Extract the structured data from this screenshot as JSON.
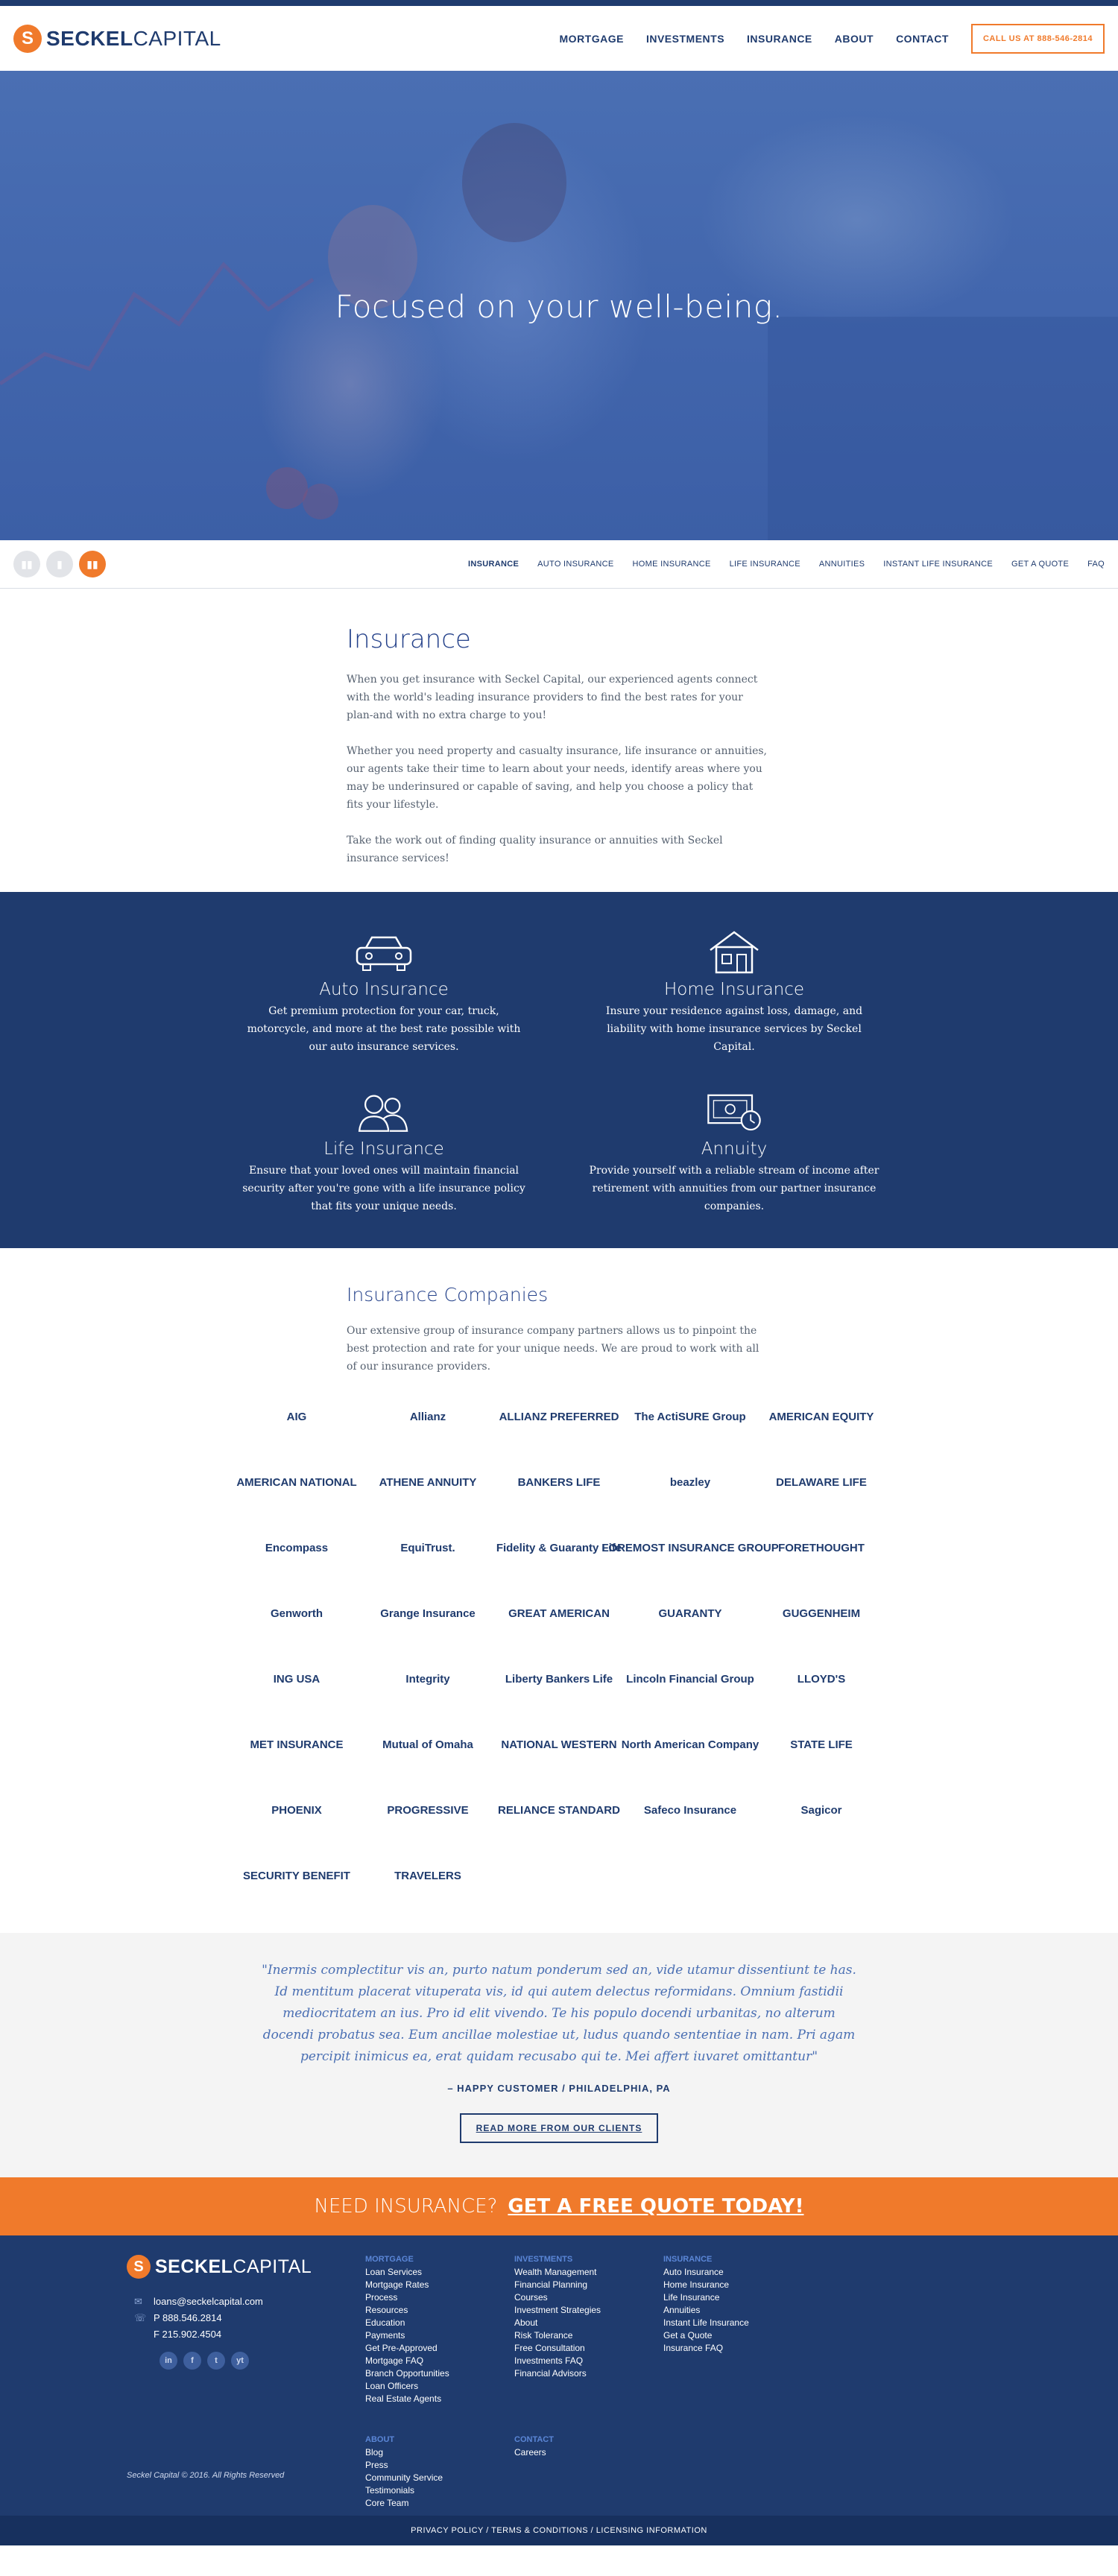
{
  "brand": {
    "bold": "SECKEL",
    "light": "CAPITAL",
    "mark": "S"
  },
  "nav": {
    "items": [
      "MORTGAGE",
      "INVESTMENTS",
      "INSURANCE",
      "ABOUT",
      "CONTACT"
    ],
    "call": "CALL US AT 888-546-2814"
  },
  "hero": {
    "title": "Focused on your well-being."
  },
  "subnav": {
    "items": [
      "INSURANCE",
      "AUTO INSURANCE",
      "HOME INSURANCE",
      "LIFE INSURANCE",
      "ANNUITIES",
      "INSTANT LIFE INSURANCE",
      "GET A QUOTE",
      "FAQ"
    ]
  },
  "intro": {
    "title": "Insurance",
    "paragraphs": [
      "When you get insurance with Seckel Capital, our experienced agents connect with the world's leading insurance providers to find the best rates for your plan-and with no extra charge to you!",
      "Whether you need property and casualty insurance, life insurance or annuities, our agents take their time to learn about your needs, identify areas where you may be underinsured or capable of saving, and help you choose a policy that fits your lifestyle.",
      "Take the work out of finding quality insurance or annuities with Seckel insurance services!"
    ]
  },
  "services": [
    {
      "title": "Auto Insurance",
      "icon": "car-icon",
      "text": "Get premium protection for your car, truck, motorcycle, and more at the best rate possible with our auto insurance services."
    },
    {
      "title": "Home Insurance",
      "icon": "house-icon",
      "text": "Insure your residence against loss, damage, and liability with home insurance services by Seckel Capital."
    },
    {
      "title": "Life Insurance",
      "icon": "people-icon",
      "text": "Ensure that your loved ones will maintain financial security after you're gone with a life insurance policy that fits your unique needs."
    },
    {
      "title": "Annuity",
      "icon": "money-clock-icon",
      "text": "Provide yourself with a reliable stream of income after retirement with annuities from our partner insurance companies."
    }
  ],
  "companies": {
    "title": "Insurance Companies",
    "text": "Our extensive group of insurance company partners allows us to pinpoint the best protection and rate for your unique needs. We are proud to work with all of our insurance providers.",
    "logos": [
      "AIG",
      "Allianz",
      "ALLIANZ PREFERRED",
      "The ActiSURE Group",
      "AMERICAN EQUITY",
      "AMERICAN NATIONAL",
      "ATHENE ANNUITY",
      "BANKERS LIFE",
      "beazley",
      "DELAWARE LIFE",
      "Encompass",
      "EquiTrust.",
      "Fidelity & Guaranty Life",
      "FOREMOST INSURANCE GROUP",
      "FORETHOUGHT",
      "Genworth",
      "Grange Insurance",
      "GREAT AMERICAN",
      "GUARANTY",
      "GUGGENHEIM",
      "ING USA",
      "Integrity",
      "Liberty Bankers Life",
      "Lincoln Financial Group",
      "LLOYD'S",
      "MET INSURANCE",
      "Mutual of Omaha",
      "NATIONAL WESTERN",
      "North American Company",
      "STATE LIFE",
      "PHOENIX",
      "PROGRESSIVE",
      "RELIANCE STANDARD",
      "Safeco Insurance",
      "Sagicor",
      "SECURITY BENEFIT",
      "TRAVELERS"
    ]
  },
  "testimonial": {
    "quote": "\"Inermis complectitur vis an, purto natum ponderum sed an, vide utamur dissentiunt te has. Id mentitum placerat vituperata vis, id qui autem delectus reformidans. Omnium fastidii mediocritatem an ius. Pro id elit vivendo. Te his populo docendi urbanitas, no alterum docendi probatus sea. Eum ancillae molestiae ut, ludus quando sententiae in nam. Pri agam percipit inimicus ea, erat quidam recusabo qui te. Mei affert iuvaret omittantur\"",
    "author": "– HAPPY CUSTOMER / PHILADELPHIA, PA",
    "button": "READ MORE FROM OUR CLIENTS"
  },
  "cta": {
    "lead": "NEED INSURANCE?",
    "link": "GET A FREE QUOTE TODAY!"
  },
  "footer": {
    "email": "loans@seckelcapital.com",
    "phone": "P 888.546.2814",
    "fax": "F 215.902.4504",
    "socials": [
      "in",
      "f",
      "t",
      "yt"
    ],
    "copyright": "Seckel Capital © 2016. All Rights Reserved",
    "columns": [
      {
        "heading": "MORTGAGE",
        "links": [
          "Loan Services",
          "Mortgage Rates",
          "Process",
          "Resources",
          "Education",
          "Payments",
          "Get Pre-Approved",
          "Mortgage FAQ",
          "Branch Opportunities",
          "Loan Officers",
          "Real Estate Agents"
        ]
      },
      {
        "heading": "INVESTMENTS",
        "links": [
          "Wealth Management",
          "Financial Planning",
          "Courses",
          "Investment Strategies",
          "About",
          "Risk Tolerance",
          "Free Consultation",
          "Investments FAQ",
          "Financial Advisors"
        ]
      },
      {
        "heading": "INSURANCE",
        "links": [
          "Auto Insurance",
          "Home Insurance",
          "Life Insurance",
          "Annuities",
          "Instant Life Insurance",
          "Get a Quote",
          "Insurance FAQ"
        ]
      },
      {
        "heading": "ABOUT",
        "links": [
          "Blog",
          "Press",
          "Community Service",
          "Testimonials",
          "Core Team"
        ]
      },
      {
        "heading": "CONTACT",
        "links": [
          "Careers"
        ]
      }
    ],
    "legal": "PRIVACY POLICY / TERMS & CONDITIONS / LICENSING INFORMATION"
  }
}
